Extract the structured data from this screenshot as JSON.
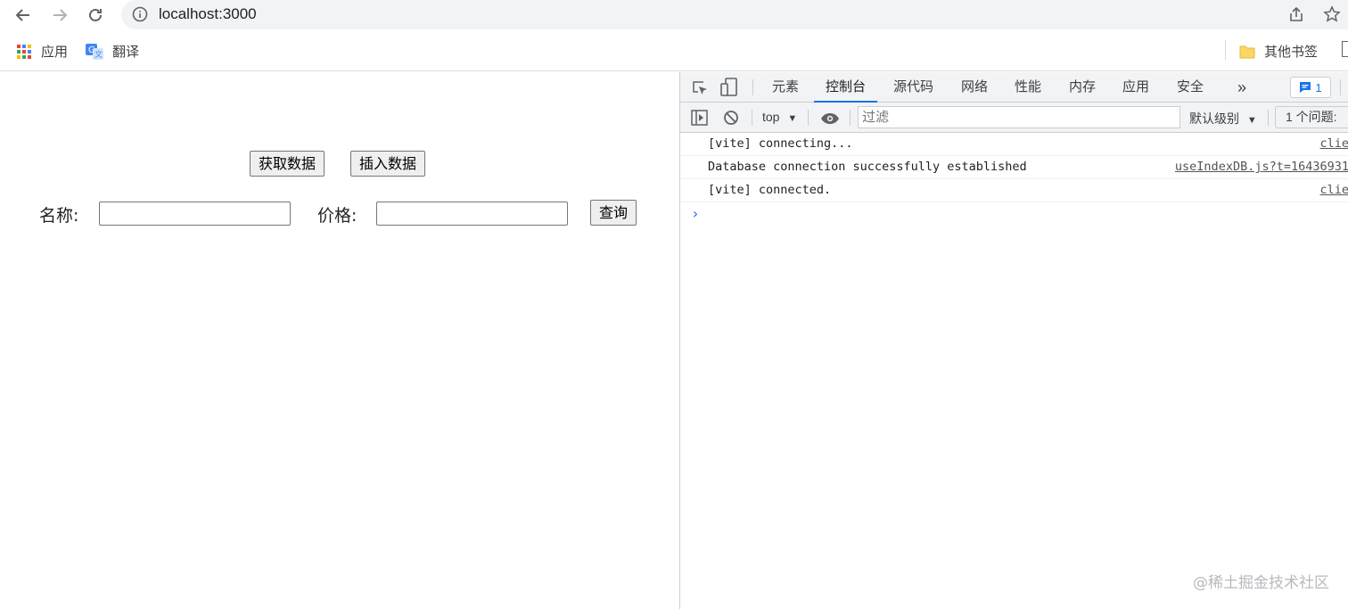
{
  "browser": {
    "url": "localhost:3000",
    "bookmarks": [
      {
        "label": "应用",
        "icon": "apps-grid-icon"
      },
      {
        "label": "翻译",
        "icon": "translate-icon"
      }
    ],
    "other_bookmarks": "其他书签"
  },
  "page": {
    "buttons": {
      "fetch": "获取数据",
      "insert": "插入数据",
      "query": "查询"
    },
    "name_label": "名称:",
    "price_label": "价格:",
    "name_value": "",
    "price_value": ""
  },
  "devtools": {
    "tabs": [
      "元素",
      "控制台",
      "源代码",
      "网络",
      "性能",
      "内存",
      "应用",
      "安全"
    ],
    "active_tab": "控制台",
    "more_tabs": "»",
    "issues_badge": "1",
    "context": "top",
    "filter_placeholder": "过滤",
    "level": "默认级别",
    "issues_count": "1 个问题:",
    "logs": [
      {
        "message": "[vite] connecting...",
        "source": "clie"
      },
      {
        "message": "Database connection successfully established",
        "source": "useIndexDB.js?t=16436931"
      },
      {
        "message": "[vite] connected.",
        "source": "clie"
      }
    ],
    "prompt": "›"
  },
  "watermark": "@稀土掘金技术社区",
  "colors": {
    "accent": "#1a73e8",
    "chrome_bg": "#f1f3f4",
    "border": "#cbcdd1"
  }
}
